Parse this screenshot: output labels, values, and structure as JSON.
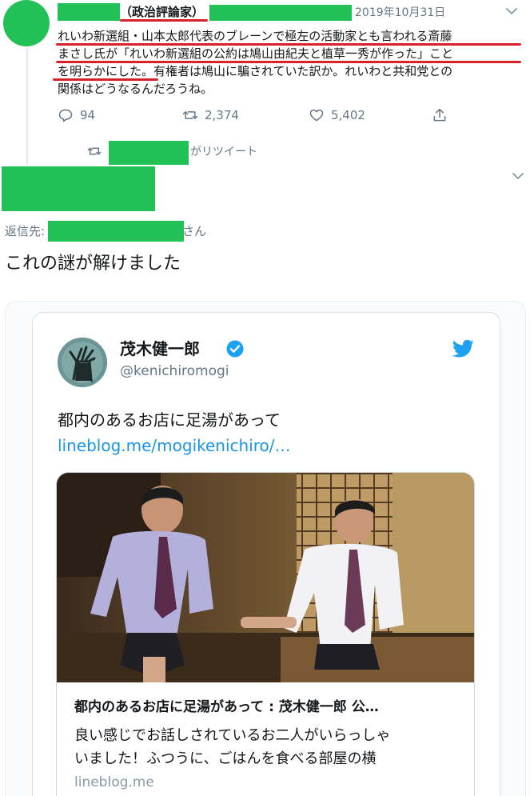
{
  "top_tweet": {
    "affiliation": "（政治評論家）",
    "date": "2019年10月31日",
    "lines": [
      "れいわ新選組・山本太郎代表のブレーンで極左の活動家とも言われる斎藤",
      "まさし氏が「れいわ新選組の公約は鳩山由紀夫と植草一秀が作った」こと",
      "を明らかにした。有権者は鳩山に騙されていた訳か。れいわと共和党との",
      "関係はどうなるんだろうね。"
    ],
    "actions": {
      "reply_count": "94",
      "retweet_count": "2,374",
      "like_count": "5,402"
    },
    "retweeted_by_suffix": "がリツイート",
    "icons": [
      "reply-icon",
      "retweet-icon",
      "like-icon",
      "share-icon",
      "chevron-down-icon"
    ]
  },
  "reply_tweet": {
    "reply_prefix": "返信先:",
    "reply_suffix": "さん",
    "text": "これの謎が解けました"
  },
  "embedded_tweet": {
    "name": "茂木健一郎",
    "handle": "@kenichiromogi",
    "text": "都内のあるお店に足湯があって",
    "link": "lineblog.me/mogikenichiro/…",
    "card": {
      "title": "都内のあるお店に足湯があって : 茂木健一郎 公…",
      "description_lines": [
        "良い感じでお話しされているお二人がいらっしゃ",
        "いました！ふつうに、ごはんを食べる部屋の横"
      ],
      "domain": "lineblog.me"
    },
    "icons": [
      "verified-badge-icon",
      "twitter-bird-icon"
    ]
  },
  "colors": {
    "redaction": "#22c158",
    "underline": "#d9212e",
    "link": "#1b95e0",
    "muted": "#657786",
    "verified": "#1da1f2"
  }
}
